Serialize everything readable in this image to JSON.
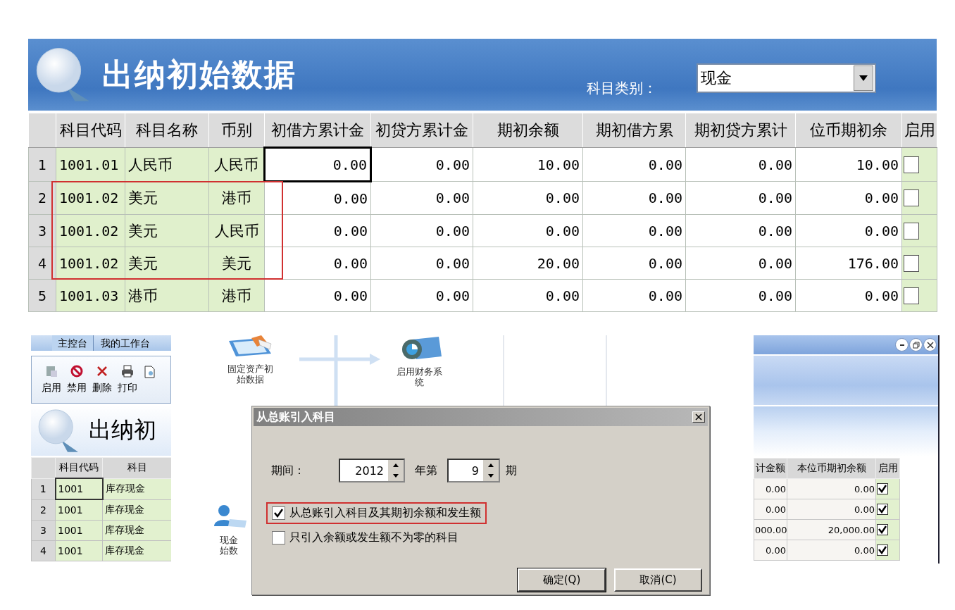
{
  "main": {
    "title": "出纳初始数据",
    "filter_label": "科目类别：",
    "filter_value": "现金",
    "columns": [
      "科目代码",
      "科目名称",
      "币别",
      "初借方累计金",
      "初贷方累计金",
      "期初余额",
      "期初借方累",
      "期初贷方累计",
      "位币期初余",
      "启用"
    ],
    "rows": [
      {
        "number": "1",
        "cells": [
          "1001.01",
          "人民币",
          "人民币",
          "0.00",
          "0.00",
          "10.00",
          "0.00",
          "0.00",
          "10.00"
        ],
        "enabled": false,
        "highlighted": false
      },
      {
        "number": "2",
        "cells": [
          "1001.02",
          "美元",
          "港币",
          "0.00",
          "0.00",
          "0.00",
          "0.00",
          "0.00",
          "0.00"
        ],
        "enabled": false,
        "highlighted": true
      },
      {
        "number": "3",
        "cells": [
          "1001.02",
          "美元",
          "人民币",
          "0.00",
          "0.00",
          "0.00",
          "0.00",
          "0.00",
          "0.00"
        ],
        "enabled": false,
        "highlighted": true
      },
      {
        "number": "4",
        "cells": [
          "1001.02",
          "美元",
          "美元",
          "0.00",
          "0.00",
          "20.00",
          "0.00",
          "0.00",
          "176.00"
        ],
        "enabled": false,
        "highlighted": true
      },
      {
        "number": "5",
        "cells": [
          "1001.03",
          "港币",
          "港币",
          "0.00",
          "0.00",
          "0.00",
          "0.00",
          "0.00",
          "0.00"
        ],
        "enabled": false,
        "highlighted": false
      }
    ]
  },
  "left_window": {
    "tabs": [
      {
        "label": "主控台",
        "selected": true
      },
      {
        "label": "我的工作台",
        "selected": false
      }
    ],
    "toolbar": [
      {
        "kind": "enable",
        "label": "启用"
      },
      {
        "kind": "disable",
        "label": "禁用"
      },
      {
        "kind": "delete",
        "label": "删除"
      },
      {
        "kind": "print",
        "label": "打印"
      },
      {
        "kind": "preview"
      }
    ],
    "title": "出纳初",
    "columns": [
      "科目代码",
      "科目"
    ],
    "rows": [
      {
        "number": "1",
        "code": "1001",
        "name": "库存现金"
      },
      {
        "number": "2",
        "code": "1001",
        "name": "库存现金"
      },
      {
        "number": "3",
        "code": "1001",
        "name": "库存现金"
      },
      {
        "number": "4",
        "code": "1001",
        "name": "库存现金"
      }
    ]
  },
  "flow": [
    {
      "kind": "fixed-assets",
      "lines": [
        "固定资产初始数据"
      ]
    },
    {
      "kind": "finance",
      "lines": [
        "启用财务系统"
      ]
    },
    {
      "kind": "cash-flow",
      "lines": [
        "现金",
        "始数"
      ]
    }
  ],
  "dialog": {
    "title": "从总账引入科目",
    "period_label": "期间：",
    "year": "2012",
    "year_suffix": "年第",
    "period": "9",
    "period_suffix": "期",
    "options": [
      {
        "label": "从总账引入科目及其期初余额和发生额",
        "checked": true,
        "highlighted": true
      },
      {
        "label": "只引入余额或发生额不为零的科目",
        "checked": false,
        "highlighted": false
      }
    ],
    "buttons": [
      "确定(Q)",
      "取消(C)"
    ]
  },
  "right_window": {
    "columns": [
      "计金额",
      "本位币期初余额",
      "启用"
    ],
    "rows": [
      {
        "cells": [
          "0.00",
          "0.00"
        ],
        "enabled": true
      },
      {
        "cells": [
          "0.00",
          "0.00"
        ],
        "enabled": true
      },
      {
        "cells": [
          "000.00",
          "20,000.00"
        ],
        "enabled": true
      },
      {
        "cells": [
          "0.00",
          "0.00"
        ],
        "enabled": true
      }
    ]
  }
}
